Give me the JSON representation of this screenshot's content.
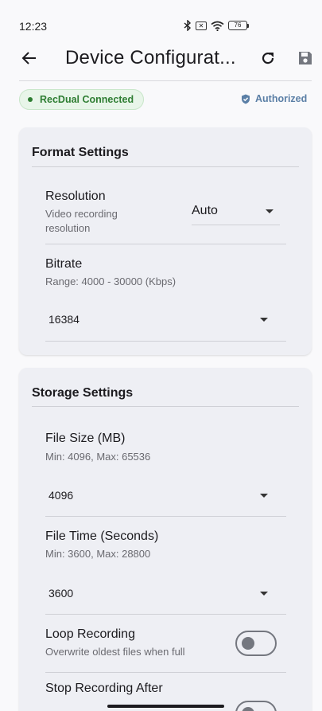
{
  "status_bar": {
    "time": "12:23",
    "battery": "76"
  },
  "app_bar": {
    "title": "Device Configurat..."
  },
  "connection": {
    "label": "RecDual Connected",
    "auth_label": "Authorized"
  },
  "format": {
    "title": "Format Settings",
    "resolution": {
      "label": "Resolution",
      "desc": "Video recording resolution",
      "value": "Auto"
    },
    "bitrate": {
      "label": "Bitrate",
      "desc": "Range: 4000 - 30000 (Kbps)",
      "value": "16384"
    }
  },
  "storage": {
    "title": "Storage Settings",
    "file_size": {
      "label": "File Size (MB)",
      "desc": "Min: 4096, Max: 65536",
      "value": "4096"
    },
    "file_time": {
      "label": "File Time (Seconds)",
      "desc": "Min: 3600, Max: 28800",
      "value": "3600"
    },
    "loop": {
      "label": "Loop Recording",
      "desc": "Overwrite oldest files when full",
      "enabled": false
    },
    "stop_after": {
      "label": "Stop Recording After",
      "enabled": false
    }
  },
  "colors": {
    "connected": "#2e7d32",
    "authorized": "#5b7fa6",
    "card": "#eeeff4"
  }
}
